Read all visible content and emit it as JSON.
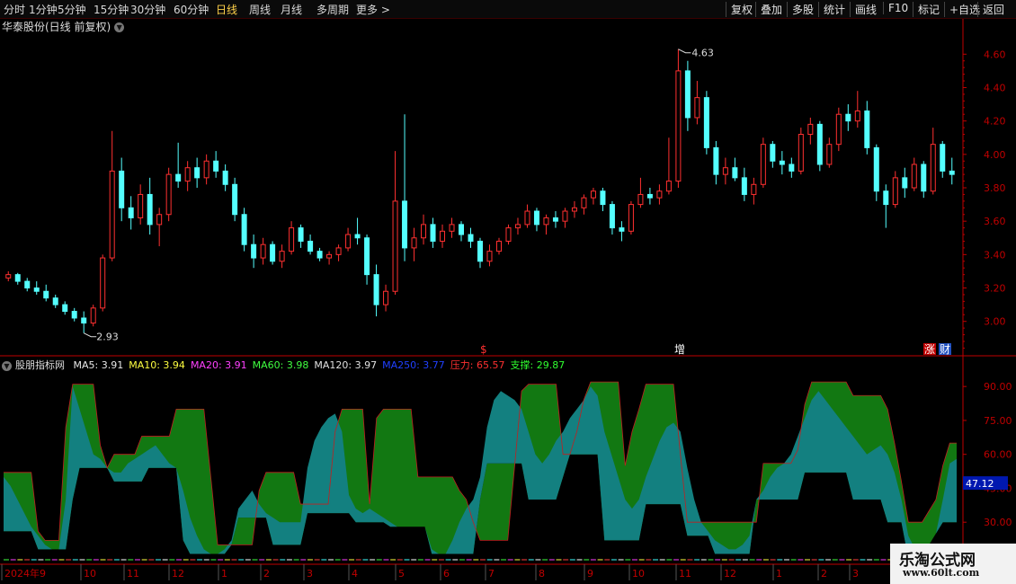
{
  "toolbar": {
    "periods": [
      "分时",
      "1分钟",
      "5分钟",
      "15分钟",
      "30分钟",
      "60分钟",
      "日线",
      "周线",
      "月线",
      "多周期",
      "更多 >"
    ],
    "active_period": "日线",
    "actions": [
      "复权",
      "叠加",
      "多股",
      "统计",
      "画线",
      "F10",
      "标记",
      "+自选",
      "返回"
    ]
  },
  "stock_title": "华泰股份(日线 前复权)",
  "colors": {
    "up": "#ff3030",
    "down": "#54ffff",
    "teal": "#138080",
    "green": "#127812",
    "axis": "#c00000"
  },
  "price_chart": {
    "type": "candlestick",
    "ylim": [
      2.88,
      4.72
    ],
    "yticks": [
      "4.60",
      "4.40",
      "4.20",
      "4.00",
      "3.80",
      "3.60",
      "3.40",
      "3.20",
      "3.00"
    ],
    "high_label": "4.63",
    "low_label": "2.93",
    "markers": [
      "$",
      "增",
      "涨",
      "财"
    ],
    "candles": [
      {
        "o": 3.26,
        "h": 3.3,
        "l": 3.24,
        "c": 3.28
      },
      {
        "o": 3.28,
        "h": 3.29,
        "l": 3.22,
        "c": 3.24
      },
      {
        "o": 3.24,
        "h": 3.26,
        "l": 3.18,
        "c": 3.2
      },
      {
        "o": 3.2,
        "h": 3.24,
        "l": 3.16,
        "c": 3.18
      },
      {
        "o": 3.18,
        "h": 3.22,
        "l": 3.12,
        "c": 3.14
      },
      {
        "o": 3.14,
        "h": 3.16,
        "l": 3.08,
        "c": 3.1
      },
      {
        "o": 3.1,
        "h": 3.12,
        "l": 3.04,
        "c": 3.06
      },
      {
        "o": 3.06,
        "h": 3.08,
        "l": 3.0,
        "c": 3.02
      },
      {
        "o": 3.02,
        "h": 3.06,
        "l": 2.93,
        "c": 2.99
      },
      {
        "o": 2.99,
        "h": 3.1,
        "l": 2.97,
        "c": 3.08
      },
      {
        "o": 3.08,
        "h": 3.4,
        "l": 3.06,
        "c": 3.38
      },
      {
        "o": 3.38,
        "h": 4.14,
        "l": 3.36,
        "c": 3.9
      },
      {
        "o": 3.9,
        "h": 3.98,
        "l": 3.6,
        "c": 3.68
      },
      {
        "o": 3.68,
        "h": 3.75,
        "l": 3.55,
        "c": 3.62
      },
      {
        "o": 3.62,
        "h": 3.82,
        "l": 3.58,
        "c": 3.76
      },
      {
        "o": 3.76,
        "h": 3.86,
        "l": 3.52,
        "c": 3.58
      },
      {
        "o": 3.58,
        "h": 3.68,
        "l": 3.45,
        "c": 3.64
      },
      {
        "o": 3.64,
        "h": 3.92,
        "l": 3.6,
        "c": 3.88
      },
      {
        "o": 3.88,
        "h": 4.07,
        "l": 3.8,
        "c": 3.84
      },
      {
        "o": 3.84,
        "h": 3.96,
        "l": 3.78,
        "c": 3.92
      },
      {
        "o": 3.92,
        "h": 3.98,
        "l": 3.8,
        "c": 3.86
      },
      {
        "o": 3.86,
        "h": 4.0,
        "l": 3.82,
        "c": 3.96
      },
      {
        "o": 3.96,
        "h": 4.02,
        "l": 3.86,
        "c": 3.9
      },
      {
        "o": 3.9,
        "h": 3.94,
        "l": 3.78,
        "c": 3.82
      },
      {
        "o": 3.82,
        "h": 3.86,
        "l": 3.6,
        "c": 3.64
      },
      {
        "o": 3.64,
        "h": 3.68,
        "l": 3.42,
        "c": 3.46
      },
      {
        "o": 3.46,
        "h": 3.52,
        "l": 3.32,
        "c": 3.38
      },
      {
        "o": 3.38,
        "h": 3.5,
        "l": 3.34,
        "c": 3.46
      },
      {
        "o": 3.46,
        "h": 3.48,
        "l": 3.34,
        "c": 3.36
      },
      {
        "o": 3.36,
        "h": 3.46,
        "l": 3.32,
        "c": 3.42
      },
      {
        "o": 3.42,
        "h": 3.6,
        "l": 3.4,
        "c": 3.56
      },
      {
        "o": 3.56,
        "h": 3.58,
        "l": 3.44,
        "c": 3.48
      },
      {
        "o": 3.48,
        "h": 3.52,
        "l": 3.4,
        "c": 3.42
      },
      {
        "o": 3.42,
        "h": 3.44,
        "l": 3.36,
        "c": 3.38
      },
      {
        "o": 3.38,
        "h": 3.42,
        "l": 3.34,
        "c": 3.4
      },
      {
        "o": 3.4,
        "h": 3.46,
        "l": 3.36,
        "c": 3.44
      },
      {
        "o": 3.44,
        "h": 3.56,
        "l": 3.42,
        "c": 3.52
      },
      {
        "o": 3.52,
        "h": 3.62,
        "l": 3.46,
        "c": 3.5
      },
      {
        "o": 3.5,
        "h": 3.52,
        "l": 3.22,
        "c": 3.28
      },
      {
        "o": 3.28,
        "h": 3.34,
        "l": 3.03,
        "c": 3.1
      },
      {
        "o": 3.1,
        "h": 3.22,
        "l": 3.06,
        "c": 3.18
      },
      {
        "o": 3.18,
        "h": 4.02,
        "l": 3.16,
        "c": 3.72
      },
      {
        "o": 3.72,
        "h": 4.24,
        "l": 3.36,
        "c": 3.44
      },
      {
        "o": 3.44,
        "h": 3.56,
        "l": 3.36,
        "c": 3.5
      },
      {
        "o": 3.5,
        "h": 3.64,
        "l": 3.46,
        "c": 3.58
      },
      {
        "o": 3.58,
        "h": 3.62,
        "l": 3.44,
        "c": 3.48
      },
      {
        "o": 3.48,
        "h": 3.58,
        "l": 3.44,
        "c": 3.54
      },
      {
        "o": 3.54,
        "h": 3.62,
        "l": 3.5,
        "c": 3.58
      },
      {
        "o": 3.58,
        "h": 3.6,
        "l": 3.48,
        "c": 3.52
      },
      {
        "o": 3.52,
        "h": 3.56,
        "l": 3.44,
        "c": 3.48
      },
      {
        "o": 3.48,
        "h": 3.5,
        "l": 3.32,
        "c": 3.36
      },
      {
        "o": 3.36,
        "h": 3.46,
        "l": 3.33,
        "c": 3.42
      },
      {
        "o": 3.42,
        "h": 3.5,
        "l": 3.4,
        "c": 3.48
      },
      {
        "o": 3.48,
        "h": 3.58,
        "l": 3.46,
        "c": 3.56
      },
      {
        "o": 3.56,
        "h": 3.62,
        "l": 3.52,
        "c": 3.58
      },
      {
        "o": 3.58,
        "h": 3.7,
        "l": 3.56,
        "c": 3.66
      },
      {
        "o": 3.66,
        "h": 3.68,
        "l": 3.54,
        "c": 3.58
      },
      {
        "o": 3.58,
        "h": 3.64,
        "l": 3.52,
        "c": 3.62
      },
      {
        "o": 3.62,
        "h": 3.66,
        "l": 3.56,
        "c": 3.6
      },
      {
        "o": 3.6,
        "h": 3.68,
        "l": 3.56,
        "c": 3.66
      },
      {
        "o": 3.66,
        "h": 3.72,
        "l": 3.62,
        "c": 3.68
      },
      {
        "o": 3.68,
        "h": 3.76,
        "l": 3.64,
        "c": 3.74
      },
      {
        "o": 3.74,
        "h": 3.8,
        "l": 3.7,
        "c": 3.78
      },
      {
        "o": 3.78,
        "h": 3.8,
        "l": 3.66,
        "c": 3.7
      },
      {
        "o": 3.7,
        "h": 3.72,
        "l": 3.52,
        "c": 3.56
      },
      {
        "o": 3.56,
        "h": 3.6,
        "l": 3.48,
        "c": 3.54
      },
      {
        "o": 3.54,
        "h": 3.72,
        "l": 3.52,
        "c": 3.7
      },
      {
        "o": 3.7,
        "h": 3.86,
        "l": 3.68,
        "c": 3.76
      },
      {
        "o": 3.76,
        "h": 3.8,
        "l": 3.7,
        "c": 3.74
      },
      {
        "o": 3.74,
        "h": 3.82,
        "l": 3.7,
        "c": 3.78
      },
      {
        "o": 3.78,
        "h": 4.1,
        "l": 3.76,
        "c": 3.84
      },
      {
        "o": 3.84,
        "h": 4.63,
        "l": 3.8,
        "c": 4.5
      },
      {
        "o": 4.5,
        "h": 4.56,
        "l": 4.14,
        "c": 4.22
      },
      {
        "o": 4.22,
        "h": 4.44,
        "l": 4.18,
        "c": 4.34
      },
      {
        "o": 4.34,
        "h": 4.38,
        "l": 4.0,
        "c": 4.04
      },
      {
        "o": 4.04,
        "h": 4.08,
        "l": 3.82,
        "c": 3.88
      },
      {
        "o": 3.88,
        "h": 3.98,
        "l": 3.82,
        "c": 3.92
      },
      {
        "o": 3.92,
        "h": 3.98,
        "l": 3.84,
        "c": 3.86
      },
      {
        "o": 3.86,
        "h": 3.92,
        "l": 3.72,
        "c": 3.76
      },
      {
        "o": 3.76,
        "h": 3.86,
        "l": 3.7,
        "c": 3.82
      },
      {
        "o": 3.82,
        "h": 4.1,
        "l": 3.8,
        "c": 4.06
      },
      {
        "o": 4.06,
        "h": 4.08,
        "l": 3.92,
        "c": 3.96
      },
      {
        "o": 3.96,
        "h": 4.02,
        "l": 3.88,
        "c": 3.94
      },
      {
        "o": 3.94,
        "h": 3.98,
        "l": 3.86,
        "c": 3.9
      },
      {
        "o": 3.9,
        "h": 4.16,
        "l": 3.88,
        "c": 4.12
      },
      {
        "o": 4.12,
        "h": 4.22,
        "l": 4.06,
        "c": 4.18
      },
      {
        "o": 4.18,
        "h": 4.2,
        "l": 3.9,
        "c": 3.94
      },
      {
        "o": 3.94,
        "h": 4.1,
        "l": 3.92,
        "c": 4.06
      },
      {
        "o": 4.06,
        "h": 4.28,
        "l": 4.02,
        "c": 4.24
      },
      {
        "o": 4.24,
        "h": 4.3,
        "l": 4.14,
        "c": 4.2
      },
      {
        "o": 4.2,
        "h": 4.38,
        "l": 4.16,
        "c": 4.26
      },
      {
        "o": 4.26,
        "h": 4.32,
        "l": 4.0,
        "c": 4.04
      },
      {
        "o": 4.04,
        "h": 4.06,
        "l": 3.72,
        "c": 3.78
      },
      {
        "o": 3.78,
        "h": 3.82,
        "l": 3.56,
        "c": 3.7
      },
      {
        "o": 3.7,
        "h": 3.9,
        "l": 3.68,
        "c": 3.86
      },
      {
        "o": 3.86,
        "h": 3.92,
        "l": 3.74,
        "c": 3.8
      },
      {
        "o": 3.8,
        "h": 3.98,
        "l": 3.78,
        "c": 3.94
      },
      {
        "o": 3.94,
        "h": 3.96,
        "l": 3.74,
        "c": 3.78
      },
      {
        "o": 3.78,
        "h": 4.16,
        "l": 3.76,
        "c": 4.06
      },
      {
        "o": 4.06,
        "h": 4.08,
        "l": 3.86,
        "c": 3.9
      },
      {
        "o": 3.9,
        "h": 3.98,
        "l": 3.82,
        "c": 3.88
      }
    ]
  },
  "chart_data": {
    "type": "area",
    "title": "股朋指标网",
    "legend": [
      {
        "label": "MA5: 3.91",
        "color": "#e8e8e8"
      },
      {
        "label": "MA10: 3.94",
        "color": "#ffff40"
      },
      {
        "label": "MA20: 3.91",
        "color": "#ff40ff"
      },
      {
        "label": "MA60: 3.98",
        "color": "#40ff40"
      },
      {
        "label": "MA120: 3.97",
        "color": "#e0e0e0"
      },
      {
        "label": "MA250: 3.77",
        "color": "#2040ff"
      },
      {
        "label": "压力: 65.57",
        "color": "#ff3030"
      },
      {
        "label": "支撑: 29.87",
        "color": "#30ff30"
      }
    ],
    "ylim": [
      13,
      100
    ],
    "yticks": [
      "90.00",
      "75.00",
      "60.00",
      "45.00",
      "30.00",
      "15.00"
    ],
    "current_value_label": "47.12",
    "x_labels": [
      "2024年9",
      "10",
      "11",
      "12",
      "1",
      "2",
      "3",
      "4",
      "5",
      "6",
      "7",
      "8",
      "9",
      "10",
      "11",
      "12",
      "1",
      "2",
      "3"
    ],
    "series": [
      {
        "name": "压力",
        "values": [
          52,
          52,
          52,
          52,
          52,
          26,
          22,
          22,
          22,
          72,
          91,
          91,
          91,
          91,
          64,
          54,
          60,
          60,
          60,
          60,
          68,
          68,
          68,
          68,
          68,
          80,
          80,
          80,
          80,
          80,
          50,
          20,
          20,
          20,
          20,
          20,
          20,
          44,
          52,
          52,
          52,
          52,
          52,
          38,
          38,
          38,
          38,
          38,
          70,
          80,
          80,
          80,
          80,
          38,
          76,
          80,
          80,
          80,
          80,
          80,
          50,
          50,
          50,
          50,
          50,
          50,
          44,
          40,
          30,
          22,
          22,
          22,
          22,
          22,
          55,
          88,
          91,
          91,
          91,
          91,
          91,
          60,
          60,
          70,
          84,
          92,
          92,
          92,
          92,
          92,
          55,
          70,
          80,
          91,
          91,
          91,
          91,
          91,
          60,
          30,
          30,
          30,
          30,
          30,
          30,
          30,
          30,
          30,
          30,
          30,
          56,
          56,
          56,
          56,
          56,
          62,
          82,
          92,
          92,
          92,
          92,
          92,
          92,
          86,
          86,
          86,
          86,
          86,
          80,
          65,
          48,
          30,
          30,
          30,
          35,
          40,
          55,
          65,
          65
        ]
      },
      {
        "name": "支撑",
        "values": [
          26,
          26,
          26,
          26,
          26,
          18,
          18,
          18,
          18,
          18,
          40,
          54,
          54,
          54,
          54,
          54,
          48,
          48,
          48,
          48,
          48,
          54,
          54,
          54,
          54,
          54,
          22,
          16,
          16,
          16,
          16,
          16,
          16,
          20,
          32,
          32,
          32,
          32,
          32,
          20,
          20,
          20,
          20,
          20,
          34,
          34,
          34,
          34,
          34,
          34,
          34,
          30,
          30,
          30,
          30,
          30,
          28,
          28,
          28,
          28,
          28,
          28,
          16,
          16,
          16,
          16,
          16,
          16,
          16,
          40,
          56,
          56,
          56,
          56,
          56,
          56,
          40,
          40,
          40,
          40,
          40,
          50,
          60,
          60,
          60,
          60,
          60,
          22,
          22,
          22,
          22,
          22,
          22,
          38,
          38,
          38,
          38,
          38,
          38,
          24,
          24,
          24,
          24,
          16,
          16,
          16,
          16,
          16,
          16,
          40,
          40,
          40,
          40,
          40,
          40,
          40,
          52,
          52,
          52,
          52,
          52,
          52,
          52,
          40,
          40,
          40,
          40,
          40,
          30,
          30,
          30,
          14,
          14,
          14,
          20,
          25,
          30,
          30,
          30
        ]
      },
      {
        "name": "主线",
        "values": [
          50,
          46,
          40,
          34,
          28,
          24,
          20,
          18,
          18,
          40,
          90,
          80,
          70,
          60,
          58,
          54,
          52,
          52,
          56,
          58,
          60,
          62,
          64,
          60,
          56,
          54,
          44,
          32,
          24,
          18,
          16,
          16,
          18,
          22,
          36,
          40,
          44,
          38,
          34,
          32,
          30,
          30,
          30,
          30,
          54,
          66,
          72,
          76,
          78,
          70,
          42,
          36,
          34,
          36,
          34,
          32,
          30,
          28,
          26,
          22,
          20,
          18,
          18,
          16,
          16,
          22,
          30,
          36,
          40,
          50,
          72,
          84,
          88,
          86,
          84,
          80,
          70,
          60,
          56,
          60,
          66,
          70,
          76,
          80,
          84,
          90,
          86,
          70,
          60,
          50,
          40,
          36,
          40,
          50,
          58,
          66,
          72,
          74,
          70,
          54,
          40,
          30,
          26,
          22,
          20,
          18,
          18,
          20,
          24,
          34,
          44,
          50,
          54,
          56,
          60,
          68,
          76,
          84,
          88,
          84,
          80,
          76,
          72,
          68,
          64,
          60,
          62,
          64,
          60,
          52,
          40,
          24,
          18,
          16,
          20,
          24,
          40,
          56,
          58
        ]
      }
    ]
  },
  "logo": {
    "line1": "乐淘公式网",
    "line2": "www.60lt.com"
  }
}
